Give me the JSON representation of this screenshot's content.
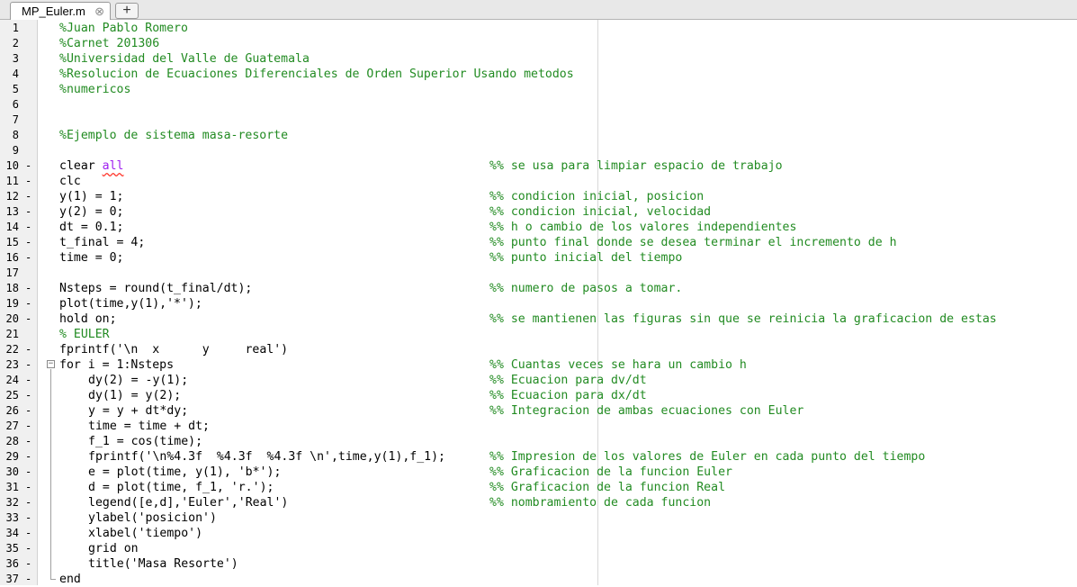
{
  "tab": {
    "label": "MP_Euler.m",
    "close": "⊗",
    "new_tab": "+"
  },
  "colors": {
    "comment": "#228B22",
    "keyword": "#0000FF",
    "string": "#A020F0",
    "text": "#000000",
    "gutter": "#f0f0f0"
  },
  "lines": [
    {
      "n": "1",
      "dash": "",
      "fold": "",
      "indent": 0,
      "tokens": [
        {
          "t": "%Juan Pablo Romero",
          "c": "comment"
        }
      ],
      "comment": ""
    },
    {
      "n": "2",
      "dash": "",
      "fold": "",
      "indent": 0,
      "tokens": [
        {
          "t": "%Carnet 201306",
          "c": "comment"
        }
      ],
      "comment": ""
    },
    {
      "n": "3",
      "dash": "",
      "fold": "",
      "indent": 0,
      "tokens": [
        {
          "t": "%Universidad del Valle de Guatemala",
          "c": "comment"
        }
      ],
      "comment": ""
    },
    {
      "n": "4",
      "dash": "",
      "fold": "",
      "indent": 0,
      "tokens": [
        {
          "t": "%Resolucion de Ecuaciones Diferenciales de Orden Superior Usando metodos",
          "c": "comment"
        }
      ],
      "comment": ""
    },
    {
      "n": "5",
      "dash": "",
      "fold": "",
      "indent": 0,
      "tokens": [
        {
          "t": "%numericos",
          "c": "comment"
        }
      ],
      "comment": ""
    },
    {
      "n": "6",
      "dash": "",
      "fold": "",
      "indent": 0,
      "tokens": [],
      "comment": ""
    },
    {
      "n": "7",
      "dash": "",
      "fold": "",
      "indent": 0,
      "tokens": [],
      "comment": ""
    },
    {
      "n": "8",
      "dash": "",
      "fold": "",
      "indent": 0,
      "tokens": [
        {
          "t": "%Ejemplo de sistema masa-resorte",
          "c": "comment"
        }
      ],
      "comment": ""
    },
    {
      "n": "9",
      "dash": "",
      "fold": "",
      "indent": 0,
      "tokens": [],
      "comment": ""
    },
    {
      "n": "10",
      "dash": "-",
      "fold": "",
      "indent": 0,
      "tokens": [
        {
          "t": "clear ",
          "c": "plain"
        },
        {
          "t": "all",
          "c": "squiggle"
        }
      ],
      "comment": "%% se usa para limpiar espacio de trabajo"
    },
    {
      "n": "11",
      "dash": "-",
      "fold": "",
      "indent": 0,
      "tokens": [
        {
          "t": "clc",
          "c": "plain"
        }
      ],
      "comment": ""
    },
    {
      "n": "12",
      "dash": "-",
      "fold": "",
      "indent": 0,
      "tokens": [
        {
          "t": "y(1) = 1;",
          "c": "plain"
        }
      ],
      "comment": "%% condicion inicial, posicion"
    },
    {
      "n": "13",
      "dash": "-",
      "fold": "",
      "indent": 0,
      "tokens": [
        {
          "t": "y(2) = 0;",
          "c": "plain"
        }
      ],
      "comment": "%% condicion inicial, velocidad"
    },
    {
      "n": "14",
      "dash": "-",
      "fold": "",
      "indent": 0,
      "tokens": [
        {
          "t": "dt = 0.1;",
          "c": "plain"
        }
      ],
      "comment": "%% h o cambio de los valores independientes"
    },
    {
      "n": "15",
      "dash": "-",
      "fold": "",
      "indent": 0,
      "tokens": [
        {
          "t": "t_final = 4;",
          "c": "plain"
        }
      ],
      "comment": "%% punto final donde se desea terminar el incremento de h"
    },
    {
      "n": "16",
      "dash": "-",
      "fold": "",
      "indent": 0,
      "tokens": [
        {
          "t": "time = 0;",
          "c": "plain"
        }
      ],
      "comment": "%% punto inicial del tiempo"
    },
    {
      "n": "17",
      "dash": "",
      "fold": "",
      "indent": 0,
      "tokens": [],
      "comment": ""
    },
    {
      "n": "18",
      "dash": "-",
      "fold": "",
      "indent": 0,
      "tokens": [
        {
          "t": "Nsteps = round(t_final/dt);",
          "c": "plain"
        }
      ],
      "comment": "%% numero de pasos a tomar."
    },
    {
      "n": "19",
      "dash": "-",
      "fold": "",
      "indent": 0,
      "tokens": [
        {
          "t": "plot(time,y(1),",
          "c": "plain"
        },
        {
          "t": "'*'",
          "c": "string"
        },
        {
          "t": ");",
          "c": "plain"
        }
      ],
      "comment": ""
    },
    {
      "n": "20",
      "dash": "-",
      "fold": "",
      "indent": 0,
      "tokens": [
        {
          "t": "hold ",
          "c": "plain"
        },
        {
          "t": "on",
          "c": "string"
        },
        {
          "t": ";",
          "c": "plain"
        }
      ],
      "comment": "%% se mantienen las figuras sin que se reinicia la graficacion de estas"
    },
    {
      "n": "21",
      "dash": "",
      "fold": "",
      "indent": 0,
      "tokens": [
        {
          "t": "% EULER",
          "c": "comment"
        }
      ],
      "comment": ""
    },
    {
      "n": "22",
      "dash": "-",
      "fold": "",
      "indent": 0,
      "tokens": [
        {
          "t": "fprintf(",
          "c": "plain"
        },
        {
          "t": "'\\n  x      y     real'",
          "c": "string"
        },
        {
          "t": ")",
          "c": "plain"
        }
      ],
      "comment": ""
    },
    {
      "n": "23",
      "dash": "-",
      "fold": "start",
      "indent": 0,
      "tokens": [
        {
          "t": "for",
          "c": "keyword"
        },
        {
          "t": " i = 1:Nsteps",
          "c": "plain"
        }
      ],
      "comment": "%% Cuantas veces se hara un cambio h"
    },
    {
      "n": "24",
      "dash": "-",
      "fold": "",
      "indent": 1,
      "tokens": [
        {
          "t": "dy(2) = -y(1);",
          "c": "plain"
        }
      ],
      "comment": "%% Ecuacion para dv/dt"
    },
    {
      "n": "25",
      "dash": "-",
      "fold": "",
      "indent": 1,
      "tokens": [
        {
          "t": "dy(1) = y(2);",
          "c": "plain"
        }
      ],
      "comment": "%% Ecuacion para dx/dt"
    },
    {
      "n": "26",
      "dash": "-",
      "fold": "",
      "indent": 1,
      "tokens": [
        {
          "t": "y = y + dt*dy;",
          "c": "plain"
        }
      ],
      "comment": "%% Integracion de ambas ecuaciones con Euler"
    },
    {
      "n": "27",
      "dash": "-",
      "fold": "",
      "indent": 1,
      "tokens": [
        {
          "t": "time = time + dt;",
          "c": "plain"
        }
      ],
      "comment": ""
    },
    {
      "n": "28",
      "dash": "-",
      "fold": "",
      "indent": 1,
      "tokens": [
        {
          "t": "f_1 = cos(time);",
          "c": "plain"
        }
      ],
      "comment": ""
    },
    {
      "n": "29",
      "dash": "-",
      "fold": "",
      "indent": 1,
      "tokens": [
        {
          "t": "fprintf(",
          "c": "plain"
        },
        {
          "t": "'\\n%4.3f  %4.3f  %4.3f \\n'",
          "c": "string"
        },
        {
          "t": ",time,y(1),f_1);",
          "c": "plain"
        }
      ],
      "comment": "%% Impresion de los valores de Euler en cada punto del tiempo"
    },
    {
      "n": "30",
      "dash": "-",
      "fold": "",
      "indent": 1,
      "tokens": [
        {
          "t": "e = plot(time, y(1), ",
          "c": "plain"
        },
        {
          "t": "'b*'",
          "c": "string"
        },
        {
          "t": ");",
          "c": "plain"
        }
      ],
      "comment": "%% Graficacion de la funcion Euler"
    },
    {
      "n": "31",
      "dash": "-",
      "fold": "",
      "indent": 1,
      "tokens": [
        {
          "t": "d = plot(time, f_1, ",
          "c": "plain"
        },
        {
          "t": "'r.'",
          "c": "string"
        },
        {
          "t": ");",
          "c": "plain"
        }
      ],
      "comment": "%% Graficacion de la funcion Real"
    },
    {
      "n": "32",
      "dash": "-",
      "fold": "",
      "indent": 1,
      "tokens": [
        {
          "t": "legend([e,d],",
          "c": "plain"
        },
        {
          "t": "'Euler'",
          "c": "string"
        },
        {
          "t": ",",
          "c": "plain"
        },
        {
          "t": "'Real'",
          "c": "string"
        },
        {
          "t": ")",
          "c": "plain"
        }
      ],
      "comment": "%% nombramiento de cada funcion"
    },
    {
      "n": "33",
      "dash": "-",
      "fold": "",
      "indent": 1,
      "tokens": [
        {
          "t": "ylabel(",
          "c": "plain"
        },
        {
          "t": "'posicion'",
          "c": "string"
        },
        {
          "t": ")",
          "c": "plain"
        }
      ],
      "comment": ""
    },
    {
      "n": "34",
      "dash": "-",
      "fold": "",
      "indent": 1,
      "tokens": [
        {
          "t": "xlabel(",
          "c": "plain"
        },
        {
          "t": "'tiempo'",
          "c": "string"
        },
        {
          "t": ")",
          "c": "plain"
        }
      ],
      "comment": ""
    },
    {
      "n": "35",
      "dash": "-",
      "fold": "",
      "indent": 1,
      "tokens": [
        {
          "t": "grid ",
          "c": "plain"
        },
        {
          "t": "on",
          "c": "string"
        }
      ],
      "comment": ""
    },
    {
      "n": "36",
      "dash": "-",
      "fold": "",
      "indent": 1,
      "tokens": [
        {
          "t": "title(",
          "c": "plain"
        },
        {
          "t": "'Masa Resorte'",
          "c": "string"
        },
        {
          "t": ")",
          "c": "plain"
        }
      ],
      "comment": ""
    },
    {
      "n": "37",
      "dash": "-",
      "fold": "end",
      "indent": 0,
      "tokens": [
        {
          "t": "end",
          "c": "keyword"
        }
      ],
      "comment": ""
    }
  ]
}
